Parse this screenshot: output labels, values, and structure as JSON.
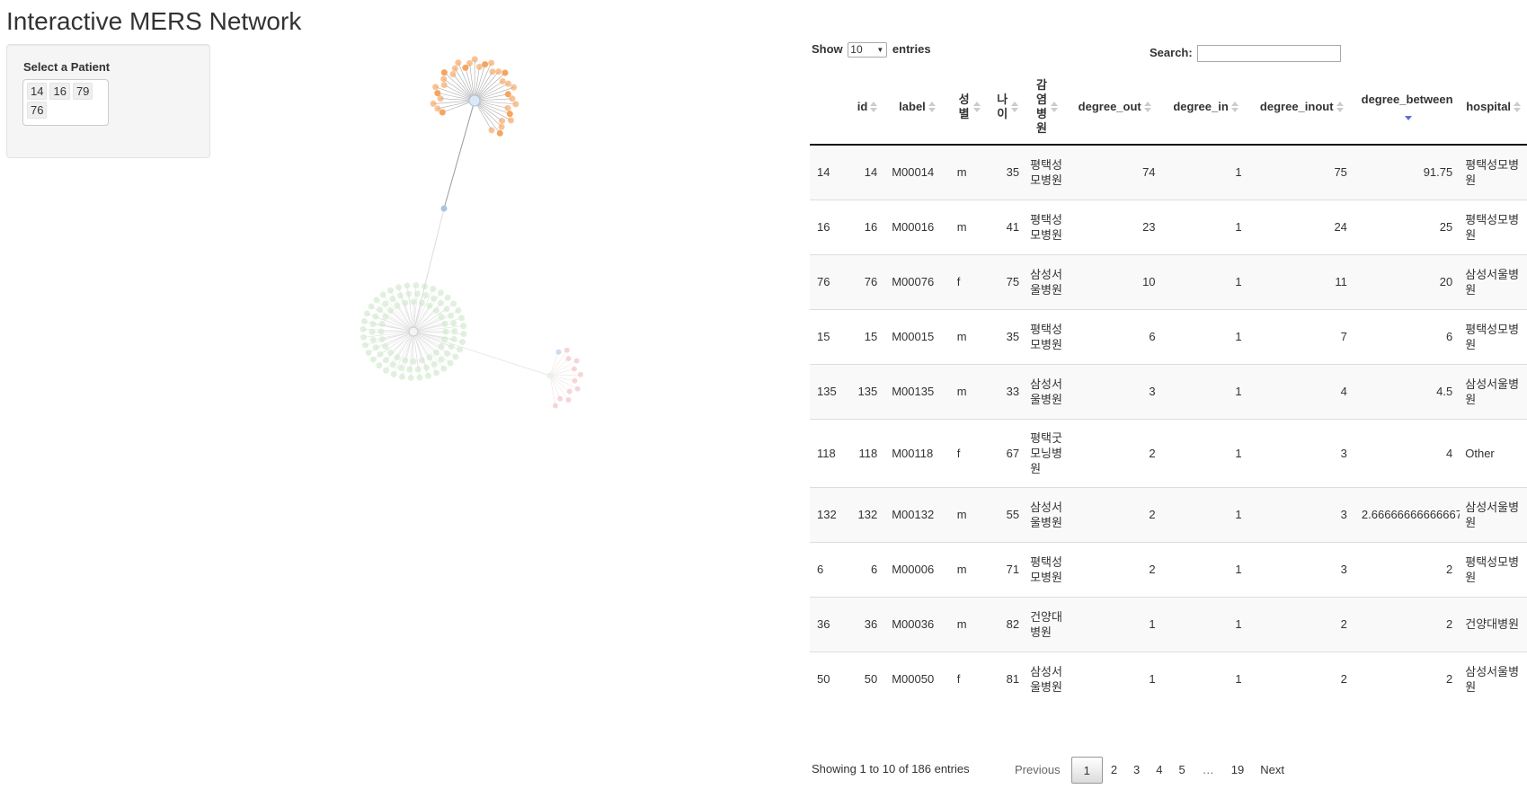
{
  "app": {
    "title": "Interactive MERS Network"
  },
  "sidebar": {
    "label": "Select a Patient",
    "selected": [
      "14",
      "16",
      "79",
      "76"
    ]
  },
  "table_controls": {
    "show_label": "Show",
    "page_length": "10",
    "entries_label": "entries",
    "search_label": "Search:",
    "search_value": ""
  },
  "table": {
    "columns": [
      "",
      "id",
      "label",
      "성별",
      "나이",
      "감염병원",
      "degree_out",
      "degree_in",
      "degree_inout",
      "degree_between",
      "hospital"
    ],
    "sorted_column": "degree_between",
    "rows": [
      [
        "14",
        "14",
        "M00014",
        "m",
        "35",
        "평택성모병원",
        "74",
        "1",
        "75",
        "91.75",
        "평택성모병원"
      ],
      [
        "16",
        "16",
        "M00016",
        "m",
        "41",
        "평택성모병원",
        "23",
        "1",
        "24",
        "25",
        "평택성모병원"
      ],
      [
        "76",
        "76",
        "M00076",
        "f",
        "75",
        "삼성서울병원",
        "10",
        "1",
        "11",
        "20",
        "삼성서울병원"
      ],
      [
        "15",
        "15",
        "M00015",
        "m",
        "35",
        "평택성모병원",
        "6",
        "1",
        "7",
        "6",
        "평택성모병원"
      ],
      [
        "135",
        "135",
        "M00135",
        "m",
        "33",
        "삼성서울병원",
        "3",
        "1",
        "4",
        "4.5",
        "삼성서울병원"
      ],
      [
        "118",
        "118",
        "M00118",
        "f",
        "67",
        "평택굿모닝병원",
        "2",
        "1",
        "3",
        "4",
        "Other"
      ],
      [
        "132",
        "132",
        "M00132",
        "m",
        "55",
        "삼성서울병원",
        "2",
        "1",
        "3",
        "2.66666666666667",
        "삼성서울병원"
      ],
      [
        "6",
        "6",
        "M00006",
        "m",
        "71",
        "평택성모병원",
        "2",
        "1",
        "3",
        "2",
        "평택성모병원"
      ],
      [
        "36",
        "36",
        "M00036",
        "m",
        "82",
        "건양대병원",
        "1",
        "1",
        "2",
        "2",
        "건양대병원"
      ],
      [
        "50",
        "50",
        "M00050",
        "f",
        "81",
        "삼성서울병원",
        "1",
        "1",
        "2",
        "2",
        "삼성서울병원"
      ]
    ]
  },
  "footer": {
    "info": "Showing 1 to 10 of 186 entries",
    "pagination": {
      "previous": "Previous",
      "pages": [
        "1",
        "2",
        "3",
        "4",
        "5",
        "…",
        "19"
      ],
      "current": "1",
      "next": "Next"
    }
  },
  "colors": {
    "cluster_orange": "#f5a560",
    "cluster_green": "#cfe8c9",
    "cluster_pink": "#f4b9bd",
    "hub_blue": "#a8c4e4",
    "sort_active": "#5a6fd6"
  }
}
